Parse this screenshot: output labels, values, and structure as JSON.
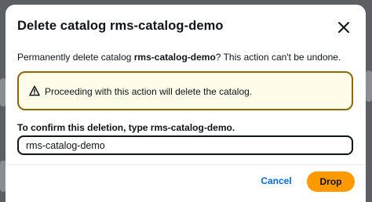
{
  "dialog": {
    "title_prefix": "Delete catalog ",
    "title_name": "rms-catalog-demo",
    "description_prefix": "Permanently delete catalog ",
    "description_name": "rms-catalog-demo",
    "description_suffix": "? This action can't be undone.",
    "close_icon": "close-icon"
  },
  "alert": {
    "icon": "warning-icon",
    "text": "Proceeding with this action will delete the catalog."
  },
  "confirm": {
    "label_prefix": "To confirm this deletion, type ",
    "label_name": "rms-catalog-demo",
    "label_suffix": ".",
    "input_value": "rms-catalog-demo"
  },
  "footer": {
    "cancel_label": "Cancel",
    "drop_label": "Drop"
  },
  "colors": {
    "primary_button": "#ff9900",
    "link": "#006ce0",
    "warning_border": "#8d6605",
    "warning_background": "#fffce9",
    "overlay": "#5c5f63"
  }
}
